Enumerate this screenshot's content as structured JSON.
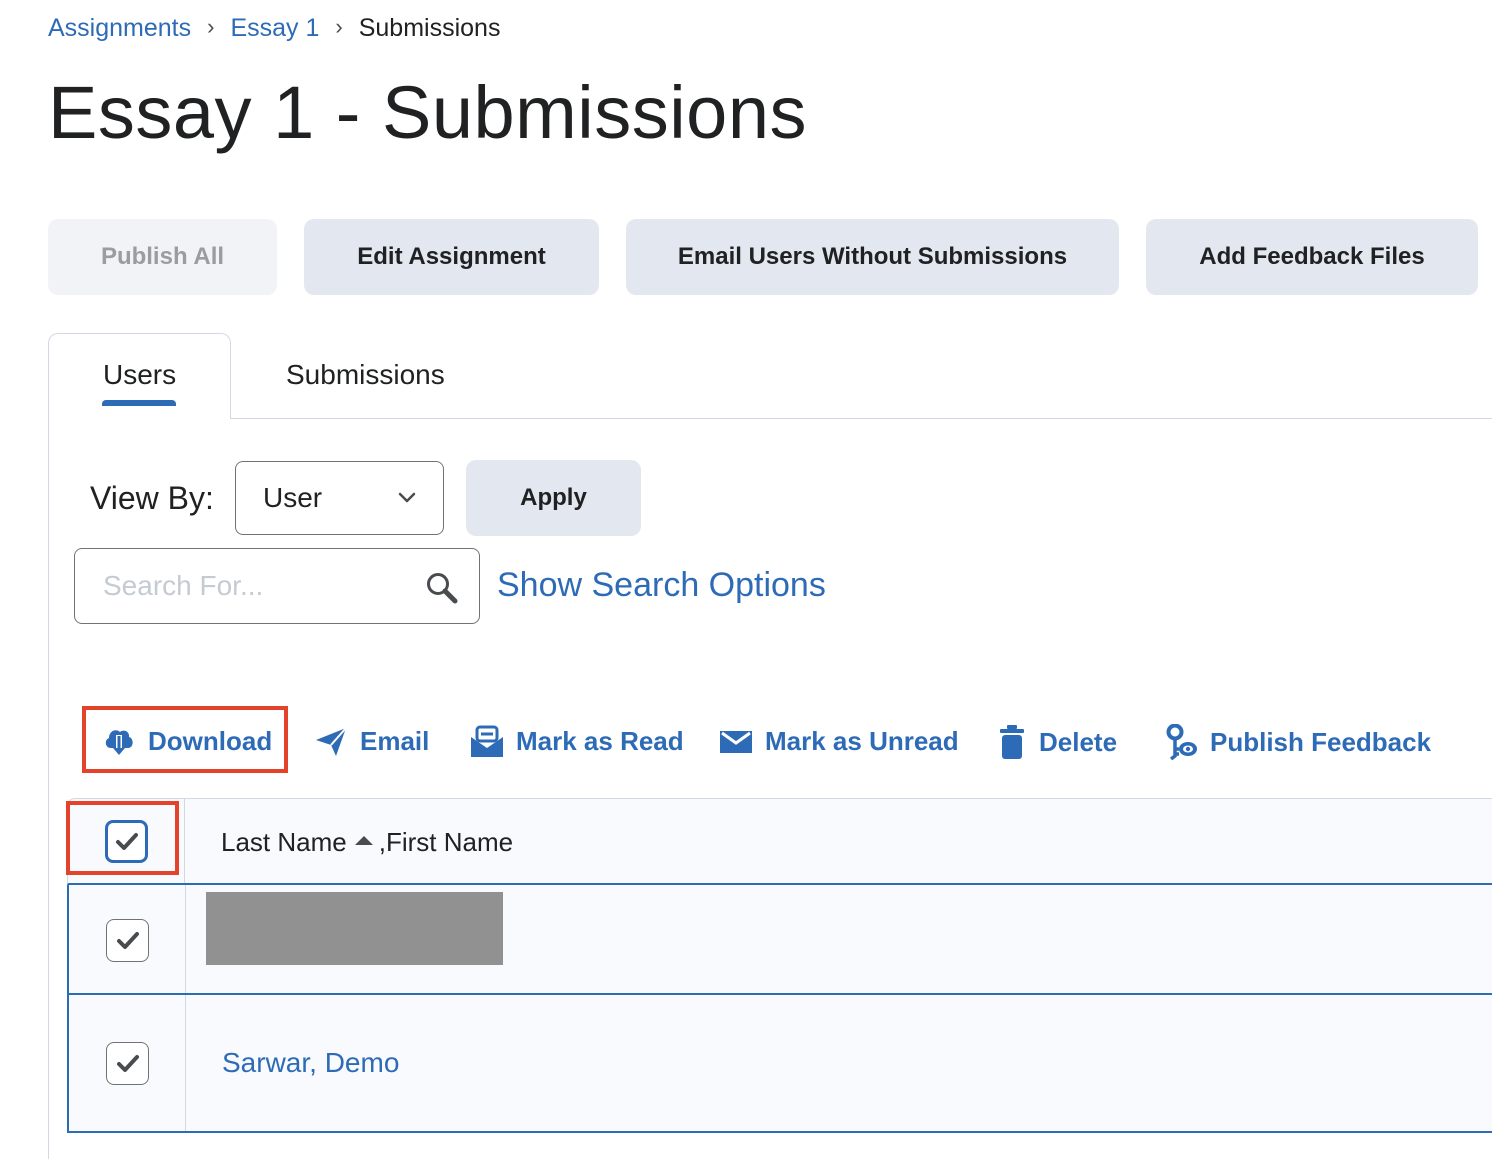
{
  "breadcrumb": {
    "items": [
      {
        "label": "Assignments",
        "link": true
      },
      {
        "label": "Essay 1",
        "link": true
      },
      {
        "label": "Submissions",
        "link": false
      }
    ],
    "separator": "›"
  },
  "page_title": "Essay 1 - Submissions",
  "toolbar": {
    "publish_all": "Publish All",
    "edit_assignment": "Edit Assignment",
    "email_users": "Email Users Without Submissions",
    "add_feedback_files": "Add Feedback Files"
  },
  "tabs": [
    {
      "label": "Users",
      "active": true
    },
    {
      "label": "Submissions",
      "active": false
    }
  ],
  "view_by": {
    "label": "View By:",
    "selected": "User",
    "apply_label": "Apply"
  },
  "search": {
    "placeholder": "Search For...",
    "value": "",
    "show_options_label": "Show Search Options"
  },
  "actions": [
    {
      "label": "Download",
      "icon": "cloud-download-icon",
      "highlighted": true
    },
    {
      "label": "Email",
      "icon": "paper-plane-icon"
    },
    {
      "label": "Mark as Read",
      "icon": "envelope-open-icon"
    },
    {
      "label": "Mark as Unread",
      "icon": "envelope-icon"
    },
    {
      "label": "Delete",
      "icon": "trash-icon"
    },
    {
      "label": "Publish Feedback",
      "icon": "publish-feedback-icon"
    }
  ],
  "table": {
    "header": {
      "select_all_checked": true,
      "column_last": "Last Name",
      "column_sep": ", ",
      "column_first": "First Name",
      "sort": "ascending"
    },
    "rows": [
      {
        "name": "",
        "redacted": true,
        "checked": true
      },
      {
        "name": "Sarwar, Demo",
        "redacted": false,
        "checked": true
      }
    ]
  },
  "colors": {
    "link": "#2e6bb7",
    "highlight": "#e2432a",
    "button_bg": "#e3e8f0"
  }
}
